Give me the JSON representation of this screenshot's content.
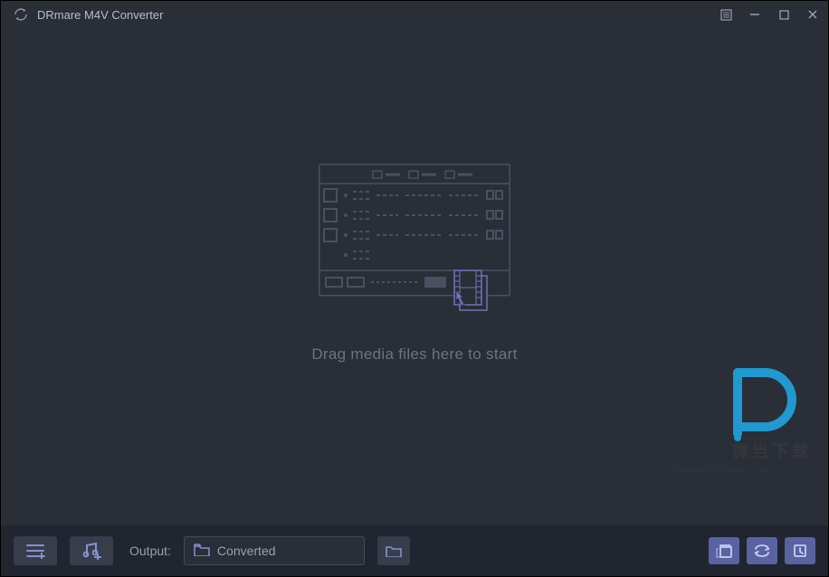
{
  "titlebar": {
    "title": "DRmare M4V Converter"
  },
  "stage": {
    "hint": "Drag media files here to start"
  },
  "footer": {
    "output_label": "Output:",
    "output_folder": "Converted"
  },
  "watermark": {
    "text": "微当下载",
    "url": "WWW.WEIDOWN.COM"
  }
}
